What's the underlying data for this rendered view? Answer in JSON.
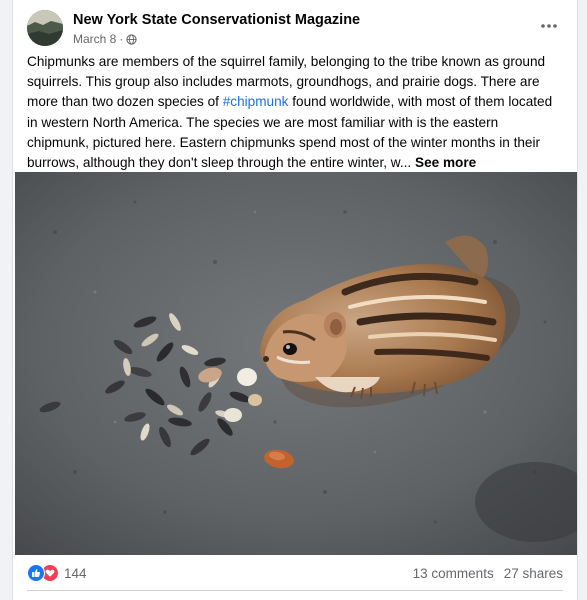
{
  "post": {
    "page_name": "New York State Conservationist Magazine",
    "date": "March 8",
    "separator": "·",
    "text_before_hashtag": "Chipmunks are members of the squirrel family, belonging to the tribe known as ground squirrels. This group also includes marmots, groundhogs, and prairie dogs. There are more than two dozen species of ",
    "hashtag": "#chipmunk",
    "text_after_hashtag": " found worldwide, with most of them located in western North America. The species we are most familiar with is the eastern chipmunk, pictured here. Eastern chipmunks spend most of the winter months in their burrows, although they don't sleep through the entire winter, w... ",
    "see_more": "See more"
  },
  "footer": {
    "reaction_count": "144",
    "comments": "13 comments",
    "shares": "27 shares"
  },
  "icons": {
    "avatar": "page-avatar",
    "privacy": "globe-icon",
    "more": "more-options-icon",
    "like": "like-icon",
    "love": "love-icon"
  },
  "colors": {
    "hashtag": "#216fdb",
    "like": "#1877f2",
    "love": "#f33e58"
  }
}
